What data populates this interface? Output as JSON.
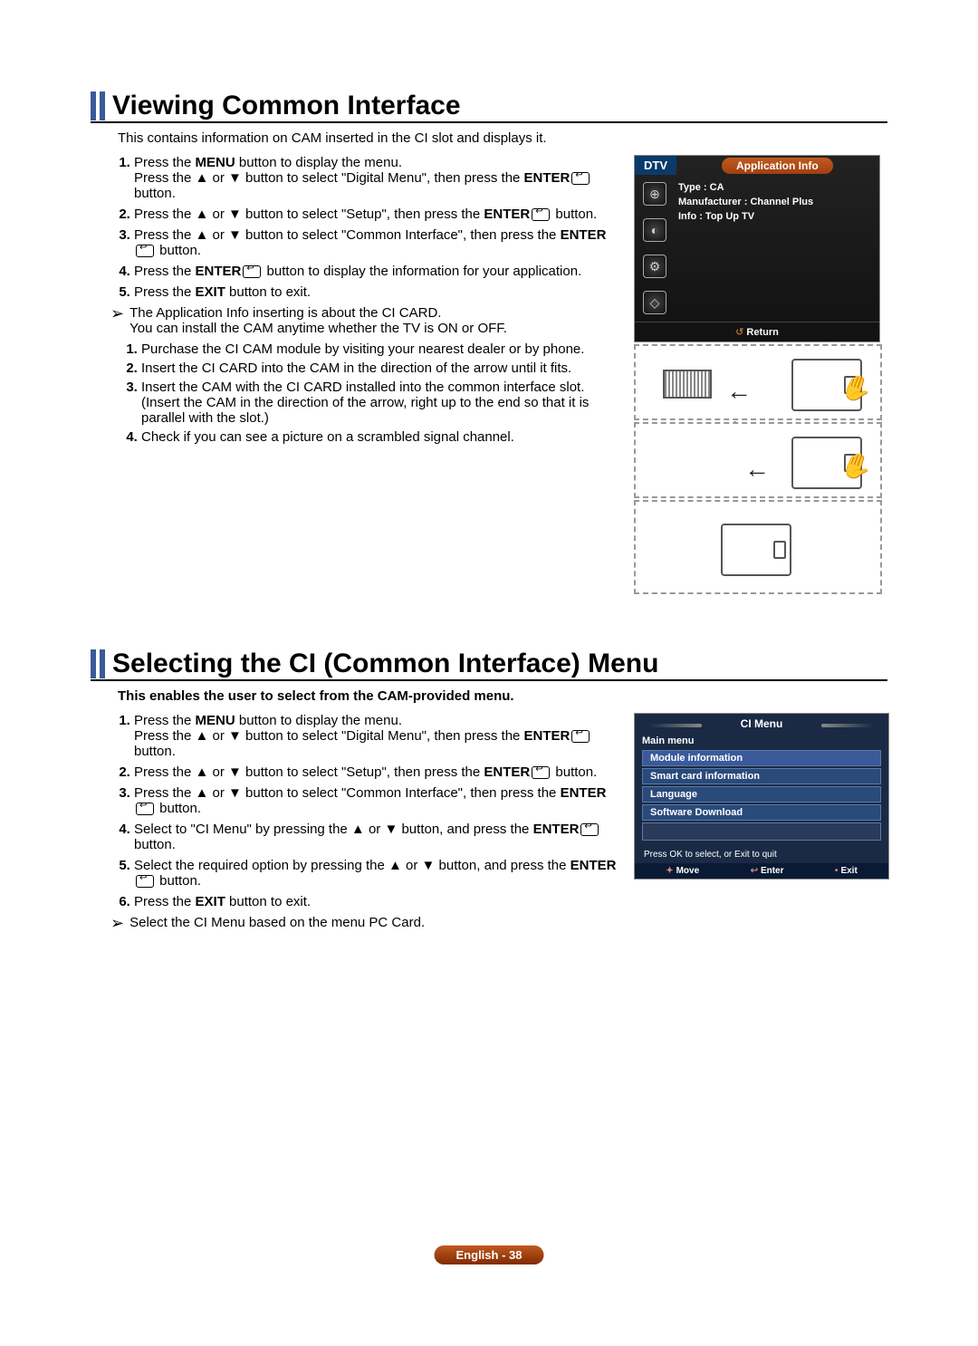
{
  "section1": {
    "heading": "Viewing Common Interface",
    "intro": "This contains information on CAM inserted in the CI slot and displays it.",
    "steps": {
      "s1a": "Press the ",
      "s1b": "MENU",
      "s1c": " button to display the menu.",
      "s1d": "Press the ▲ or ▼ button to select \"Digital Menu\", then press the ",
      "s1e": "ENTER",
      "s1f": " button.",
      "s2a": "Press the ▲ or ▼ button to select \"Setup\", then press the ",
      "s2b": "ENTER",
      "s2c": " button.",
      "s3a": "Press the ▲ or ▼ button to select \"Common Interface\", then press the ",
      "s3b": "ENTER",
      "s3c": " button.",
      "s4a": "Press the ",
      "s4b": "ENTER",
      "s4c": " button to display the information for your application.",
      "s5a": "Press the ",
      "s5b": "EXIT",
      "s5c": " button to exit."
    },
    "note": {
      "l1": "The Application Info inserting is about the CI CARD.",
      "l2": "You can install the CAM anytime whether the TV is ON or OFF."
    },
    "sub": {
      "s1": "Purchase the CI CAM module by visiting your nearest dealer or by phone.",
      "s2": "Insert the CI CARD into the CAM in the direction of the arrow until it fits.",
      "s3": "Insert the CAM with the CI CARD installed into the common interface slot.",
      "s3b": "(Insert the CAM in the direction of the arrow, right up to the end so that it is parallel with the slot.)",
      "s4": "Check if you can see a picture on a scrambled signal channel."
    }
  },
  "dtv": {
    "tag": "DTV",
    "tab": "Application Info",
    "type": "Type : CA",
    "manu": "Manufacturer : Channel Plus",
    "info": "Info : Top Up TV",
    "return": "Return"
  },
  "section2": {
    "heading": "Selecting the CI (Common Interface) Menu",
    "intro": "This enables the user to select from the CAM-provided menu.",
    "steps": {
      "s1a": "Press the ",
      "s1b": "MENU",
      "s1c": " button to display the menu.",
      "s1d": "Press the ▲ or ▼ button to select \"Digital Menu\", then press the ",
      "s1e": "ENTER",
      "s1f": " button.",
      "s2a": "Press the ▲ or ▼ button to select \"Setup\", then press the ",
      "s2b": "ENTER",
      "s2c": " button.",
      "s3a": "Press the ▲ or ▼ button to select \"Common Interface\", then press the ",
      "s3b": "ENTER",
      "s3c": " button.",
      "s4a": "Select to \"CI Menu\" by pressing the ▲ or ▼ button, and press the ",
      "s4b": "ENTER",
      "s4c": " button.",
      "s5a": "Select the required option by pressing the ▲ or ▼ button, and press the ",
      "s5b": "ENTER",
      "s5c": " button.",
      "s6a": "Press the ",
      "s6b": "EXIT",
      "s6c": " button to exit."
    },
    "note": "Select the CI Menu based on the menu PC Card."
  },
  "ci": {
    "title": "CI Menu",
    "main": "Main menu",
    "items": {
      "i0": "Module information",
      "i1": "Smart card information",
      "i2": "Language",
      "i3": "Software Download"
    },
    "hint": "Press OK to select, or Exit to quit",
    "move": "Move",
    "enter": "Enter",
    "exit": "Exit"
  },
  "footer": "English - 38"
}
